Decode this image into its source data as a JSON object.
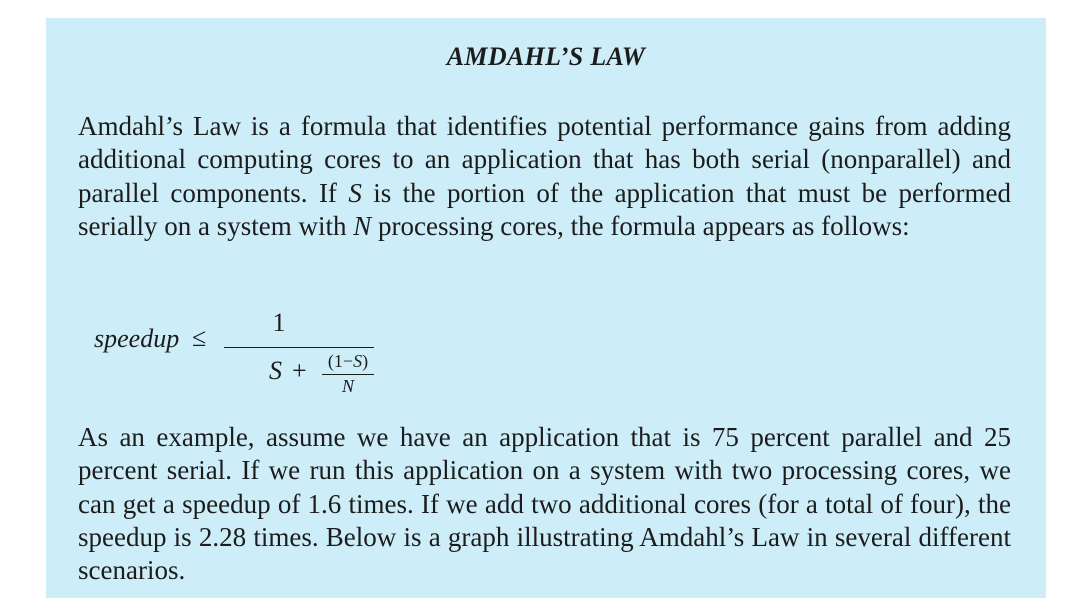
{
  "sidebar": {
    "title": "AMDAHL’S LAW",
    "intro": {
      "part1": "Amdahl’s Law is a formula that identifies potential performance gains from adding additional computing cores to an application that has both serial (nonparallel) and parallel components. If ",
      "var_s": "S",
      "part2": " is the portion of the application that must be performed serially on a system with ",
      "var_n": "N",
      "part3": " processing cores, the formula appears as follows:"
    },
    "formula": {
      "lhs": "speedup",
      "relation": "≤",
      "numerator": "1",
      "denominator_term": "S",
      "plus": "+",
      "inner_numerator_open": "(1−",
      "inner_numerator_var": "S",
      "inner_numerator_close": ")",
      "inner_denominator": "N"
    },
    "example": "As an example, assume we have an application that is 75 percent parallel and 25 percent serial. If we run this application on a system with two processing cores, we can get a speedup of 1.6 times. If we add two additional cores (for a total of four), the speedup is 2.28 times. Below is a graph illustrating Amdahl’s Law in several different scenarios."
  }
}
